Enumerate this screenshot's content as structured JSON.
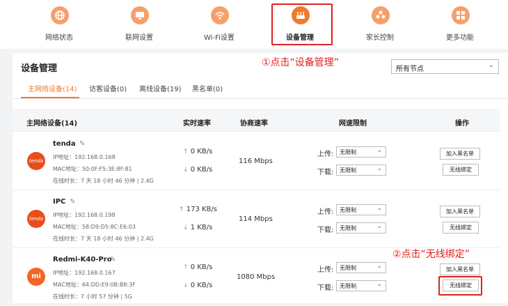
{
  "nav": {
    "items": [
      {
        "label": "网络状态",
        "icon": "globe-icon"
      },
      {
        "label": "联网设置",
        "icon": "monitor-icon"
      },
      {
        "label": "Wi-Fi设置",
        "icon": "wifi-icon"
      },
      {
        "label": "设备管理",
        "icon": "router-icon",
        "active": true
      },
      {
        "label": "家长控制",
        "icon": "family-icon"
      },
      {
        "label": "更多功能",
        "icon": "grid-icon"
      }
    ]
  },
  "annotations": {
    "step1": "①点击“设备管理”",
    "step2": "②点击“无线绑定”"
  },
  "page": {
    "title": "设备管理",
    "node_select": "所有节点",
    "tabs": [
      "主网络设备(14)",
      "访客设备(0)",
      "离线设备(19)",
      "黑名单(0)"
    ]
  },
  "table": {
    "headers": [
      "主网络设备(14)",
      "实时速率",
      "协商速率",
      "网速限制",
      "操作"
    ],
    "rows": [
      {
        "avatar": "tenda",
        "name": "tenda",
        "ip": "IP地址：192.168.0.168",
        "mac": "MAC地址：50:0F:F5:3E:8F:81",
        "online": "在线时长：7 天 18 小时 46 分钟 | 2.4G",
        "up_rate": "0 KB/s",
        "down_rate": "0 KB/s",
        "negotiated": "116 Mbps",
        "upload_label": "上传:",
        "upload_limit": "无限制",
        "download_label": "下载:",
        "download_limit": "无限制",
        "blacklist_btn": "加入黑名单",
        "bind_btn": "无线绑定"
      },
      {
        "avatar": "tenda",
        "name": "IPC",
        "ip": "IP地址：192.168.0.198",
        "mac": "MAC地址：58:D9:D5:8C:E6:03",
        "online": "在线时长：7 天 18 小时 46 分钟 | 2.4G",
        "up_rate": "173 KB/s",
        "down_rate": "1 KB/s",
        "negotiated": "114 Mbps",
        "upload_label": "上传:",
        "upload_limit": "无限制",
        "download_label": "下载:",
        "download_limit": "无限制",
        "blacklist_btn": "加入黑名单",
        "bind_btn": "无线绑定"
      },
      {
        "avatar": "mi",
        "name": "Redmi-K40-Pro",
        "ip": "IP地址：192.168.0.167",
        "mac": "MAC地址：64:DD:E9:0B:B8:3F",
        "online": "在线时长：7 小时 57 分钟 | 5G",
        "up_rate": "0 KB/s",
        "down_rate": "0 KB/s",
        "negotiated": "1080 Mbps",
        "upload_label": "上传:",
        "upload_limit": "无限制",
        "download_label": "下载:",
        "download_limit": "无限制",
        "blacklist_btn": "加入黑名单",
        "bind_btn": "无线绑定"
      }
    ]
  },
  "colors": {
    "accent": "#f07b2a",
    "annotation": "#e02020"
  }
}
